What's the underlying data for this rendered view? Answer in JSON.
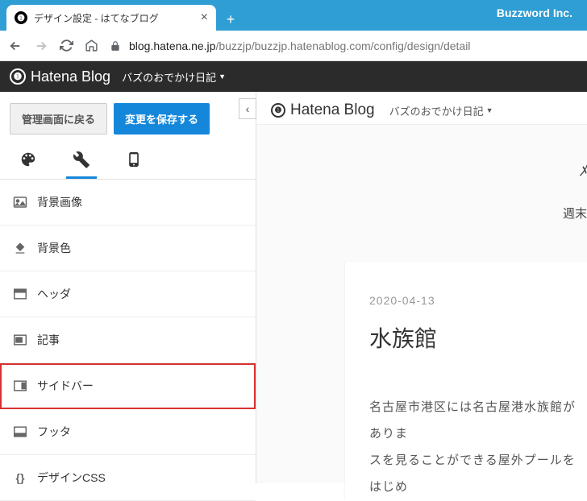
{
  "browser": {
    "tab_title": "デザイン設定 - はてなブログ",
    "brand": "Buzzword Inc.",
    "url_prefix": "blog.hatena.ne.jp",
    "url_path": "/buzzjp/buzzjp.hatenablog.com/config/design/detail"
  },
  "header": {
    "logo_text": "Hatena Blog",
    "blog_name": "バズのおでかけ日記"
  },
  "sidebar": {
    "back_label": "管理画面に戻る",
    "save_label": "変更を保存する",
    "menu": [
      {
        "label": "背景画像"
      },
      {
        "label": "背景色"
      },
      {
        "label": "ヘッダ"
      },
      {
        "label": "記事"
      },
      {
        "label": "サイドバー"
      },
      {
        "label": "フッタ"
      },
      {
        "label": "デザインCSS"
      }
    ]
  },
  "preview": {
    "logo_text": "Hatena Blog",
    "blog_name": "バズのおでかけ日記",
    "teaser_icon": "ﾒ",
    "teaser_text": "週末",
    "article": {
      "date": "2020-04-13",
      "title": "水族館",
      "body_line1": "名古屋市港区には名古屋港水族館がありま",
      "body_line2": "スを見ることができる屋外プールをはじめ"
    }
  }
}
